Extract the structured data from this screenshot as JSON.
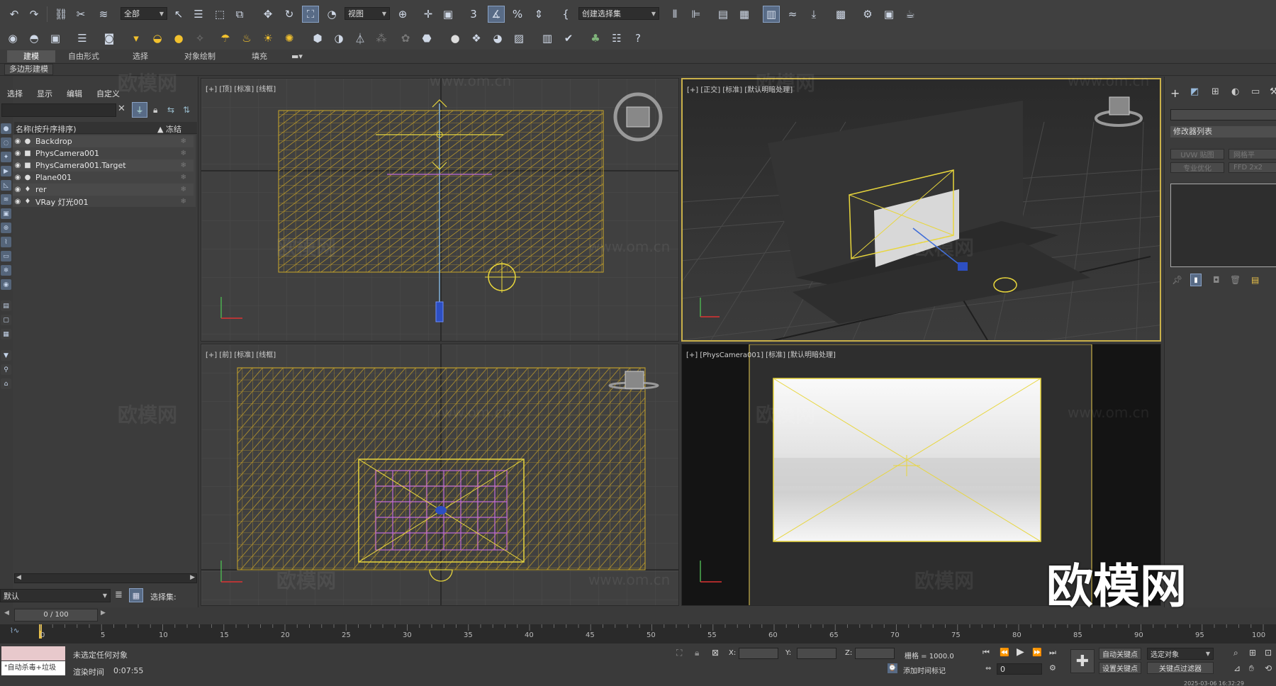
{
  "toolbar": {
    "selection_filter": "全部",
    "view_ref": "视图",
    "named_selection": "创建选择集",
    "percent_icon_label": "3"
  },
  "ribbon": {
    "tabs": [
      "建模",
      "自由形式",
      "选择",
      "对象绘制",
      "填充"
    ],
    "subtitle": "多边形建模"
  },
  "scene_explorer": {
    "menu": [
      "选择",
      "显示",
      "编辑",
      "自定义"
    ],
    "col_name": "名称(按升序排序)",
    "col_freeze": "▲ 冻结",
    "items": [
      {
        "name": "Backdrop",
        "icon": "sphere-icon"
      },
      {
        "name": "PhysCamera001",
        "icon": "camera-icon"
      },
      {
        "name": "PhysCamera001.Target",
        "icon": "camera-icon"
      },
      {
        "name": "Plane001",
        "icon": "sphere-icon"
      },
      {
        "name": "rer",
        "icon": "light-icon"
      },
      {
        "name": "VRay 灯光001",
        "icon": "light-icon"
      }
    ],
    "layer": "默认",
    "selection_set_label": "选择集:"
  },
  "viewports": {
    "top": "[+] [顶] [标准] [线框]",
    "perspective": "[+] [正交] [标准] [默认明暗处理]",
    "front": "[+] [前] [标准] [线框]",
    "camera": "[+] [PhysCamera001] [标准] [默认明暗处理]"
  },
  "command_panel": {
    "modifier_list": "修改器列表",
    "btn_uvw": "UVW 贴图",
    "btn_mesh": "网格平",
    "btn_opt": "专业优化",
    "btn_ffd": "FFD 2x2"
  },
  "timeline": {
    "frame": "0 / 100",
    "ticks": [
      "0",
      "5",
      "10",
      "15",
      "20",
      "25",
      "30",
      "35",
      "40",
      "45",
      "50",
      "55",
      "60",
      "65",
      "70",
      "75",
      "80",
      "85",
      "90",
      "95",
      "100"
    ]
  },
  "status": {
    "maxscript": "\"自动杀毒+垃圾",
    "selection": "未选定任何对象",
    "render_time_label": "渲染时间",
    "render_time": "0:07:55",
    "x_label": "X:",
    "y_label": "Y:",
    "z_label": "Z:",
    "grid": "栅格 = 1000.0",
    "add_time_tag": "添加时间标记",
    "auto_key": "自动关键点",
    "set_key": "设置关键点",
    "selected_obj": "选定对象",
    "key_filter": "关键点过滤器",
    "frame_input": "0",
    "datetime": "2025-03-06 16:32:29"
  },
  "watermark": {
    "big": "欧模网",
    "small": "欧模网",
    "url": "www.om.cn"
  },
  "colors": {
    "wire_yellow": "#c8a62a",
    "selection_yellow": "#e8d63c",
    "active_border": "#c9b04a",
    "accent_blue": "#586b86"
  }
}
